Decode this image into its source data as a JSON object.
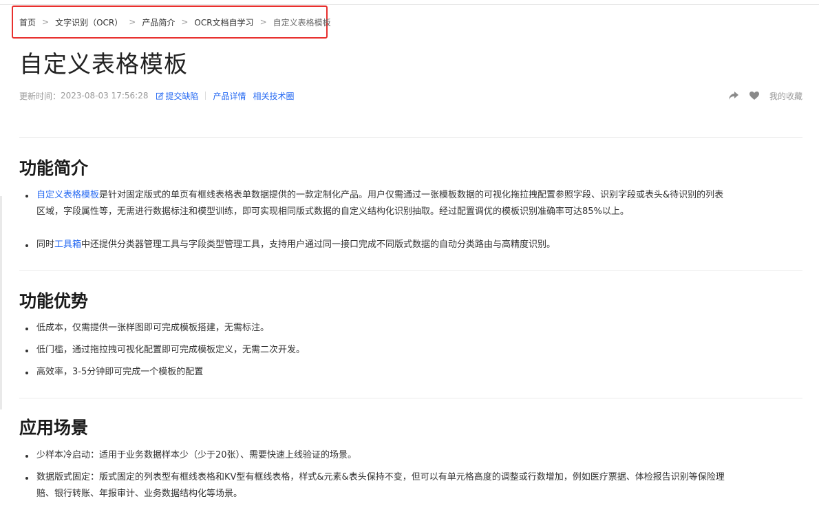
{
  "breadcrumb": {
    "items": [
      "首页",
      "文字识别（OCR）",
      "产品简介",
      "OCR文档自学习"
    ],
    "current": "自定义表格模板",
    "separator": ">"
  },
  "page": {
    "title": "自定义表格模板"
  },
  "meta": {
    "updated_label": "更新时间：",
    "updated_value": "2023-08-03 17:56:28",
    "submit_bug": "提交缺陷",
    "product_detail": "产品详情",
    "tech_circle": "相关技术圈"
  },
  "actions": {
    "share_icon": "share-icon",
    "heart_icon": "heart-icon",
    "favorites": "我的收藏"
  },
  "sections": {
    "intro": {
      "heading": "功能简介",
      "item1_link": "自定义表格模板",
      "item1_text": "是针对固定版式的单页有框线表格表单数据提供的一款定制化产品。用户仅需通过一张模板数据的可视化拖拉拽配置参照字段、识别字段或表头&待识别的列表",
      "item1_text2": "区域，字段属性等，无需进行数据标注和模型训练，即可实现相同版式数据的自定义结构化识别抽取。经过配置调优的模板识别准确率可达85%以上。",
      "item2_pre": "同时",
      "item2_link": "工具箱",
      "item2_post": "中还提供分类器管理工具与字段类型管理工具，支持用户通过同一接口完成不同版式数据的自动分类路由与高精度识别。"
    },
    "advantages": {
      "heading": "功能优势",
      "items": [
        "低成本，仅需提供一张样图即可完成模板搭建，无需标注。",
        "低门槛，通过拖拉拽可视化配置即可完成模板定义，无需二次开发。",
        "高效率，3-5分钟即可完成一个模板的配置"
      ]
    },
    "scenarios": {
      "heading": "应用场景",
      "item1": "少样本冷启动：适用于业务数据样本少（少于20张）、需要快速上线验证的场景。",
      "item2_line1": "数据版式固定：版式固定的列表型有框线表格和KV型有框线表格，样式&元素&表头保持不变，但可以有单元格高度的调整或行数增加，例如医疗票据、体检报告识别等保险理",
      "item2_line2": "赔、银行转账、年报审计、业务数据结构化等场景。"
    }
  },
  "colors": {
    "link": "#2468f2",
    "highlight_border": "#e8302e",
    "muted": "#999999"
  }
}
